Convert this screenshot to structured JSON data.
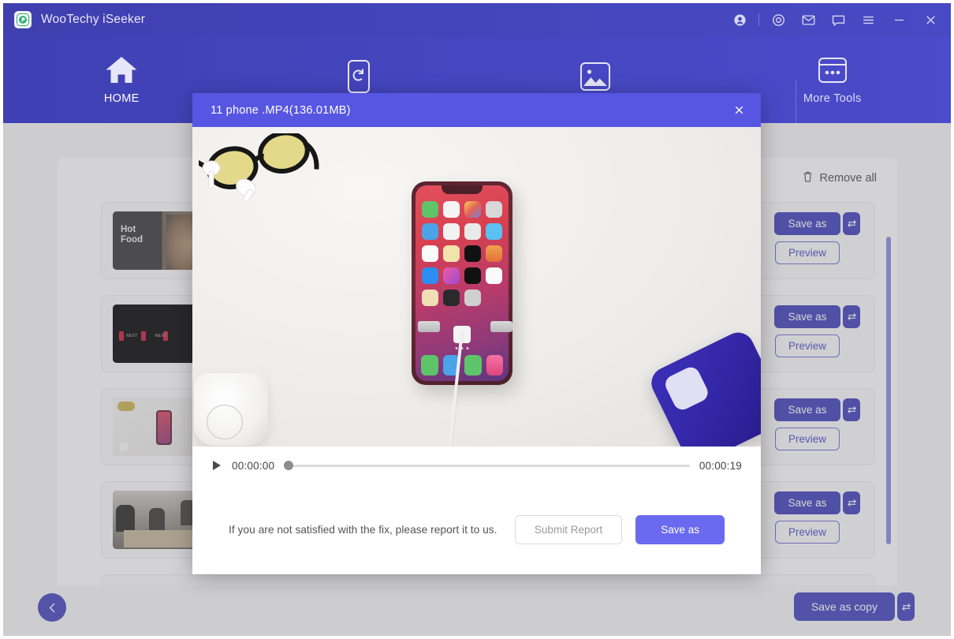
{
  "window": {
    "title": "WooTechy iSeeker",
    "logo_icon": "app-logo-icon",
    "titlebar_icons": [
      {
        "name": "account-icon",
        "glyph": "account"
      },
      {
        "name": "target-icon",
        "glyph": "target"
      },
      {
        "name": "mail-icon",
        "glyph": "mail"
      },
      {
        "name": "chat-icon",
        "glyph": "chat"
      },
      {
        "name": "menu-icon",
        "glyph": "menu"
      },
      {
        "name": "minimize-icon",
        "glyph": "minimize"
      },
      {
        "name": "close-icon",
        "glyph": "close"
      }
    ]
  },
  "nav": {
    "items": [
      {
        "label": "HOME",
        "icon": "home-icon"
      },
      {
        "label": "",
        "icon": "phone-refresh-icon"
      },
      {
        "label": "",
        "icon": "photo-icon"
      },
      {
        "label": "More Tools",
        "icon": "more-tools-icon"
      }
    ]
  },
  "panel": {
    "remove_all_label": "Remove all",
    "remove_all_icon": "trash-icon",
    "rows": [
      {
        "save_label": "Save as",
        "preview_label": "Preview",
        "swap_icon": "swap-icon",
        "thumb": "hot-food-video"
      },
      {
        "save_label": "Save as",
        "preview_label": "Preview",
        "swap_icon": "swap-icon",
        "thumb": "nba-next-video"
      },
      {
        "save_label": "Save as",
        "preview_label": "Preview",
        "swap_icon": "swap-icon",
        "thumb": "phone-desk-video"
      },
      {
        "save_label": "Save as",
        "preview_label": "Preview",
        "swap_icon": "swap-icon",
        "thumb": "people-table-video"
      }
    ],
    "thumb_overlay_texts": {
      "row1_line1": "Hot",
      "row1_line2": "Food",
      "row2_text": "NEXT"
    }
  },
  "footer": {
    "back_icon": "back-arrow-icon",
    "save_copy_label": "Save as copy",
    "swap_icon": "swap-icon"
  },
  "modal": {
    "title": "11 phone .MP4(136.01MB)",
    "close_icon": "close-icon",
    "player": {
      "play_icon": "play-icon",
      "current_time": "00:00:00",
      "total_time": "00:00:19",
      "progress_percent": 0
    },
    "footer": {
      "message": "If you are not satisfied with the fix, please report it to us.",
      "submit_label": "Submit Report",
      "save_label": "Save as"
    }
  },
  "colors": {
    "titlebar": "#4545bc",
    "navbar": "#4646c0",
    "modal_header": "#5656e2",
    "primary_button": "#3f3fb8",
    "modal_save_button": "#6a6af0",
    "page_background": "#f2f2f4"
  }
}
